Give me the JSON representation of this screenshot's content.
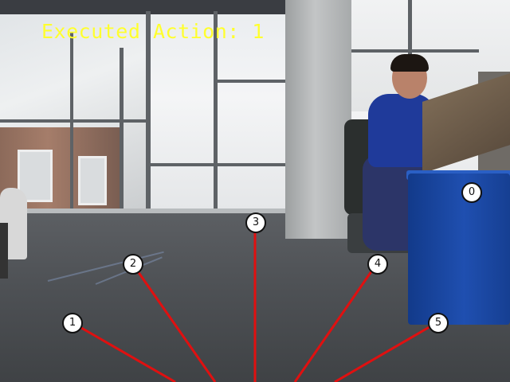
{
  "status": {
    "text": "Executed Action: 1",
    "color": "#ffff2e"
  },
  "overlay": {
    "ray_color": "#e01010",
    "markers": [
      {
        "label": "0"
      },
      {
        "label": "1"
      },
      {
        "label": "2"
      },
      {
        "label": "3"
      },
      {
        "label": "4"
      },
      {
        "label": "5"
      }
    ]
  }
}
